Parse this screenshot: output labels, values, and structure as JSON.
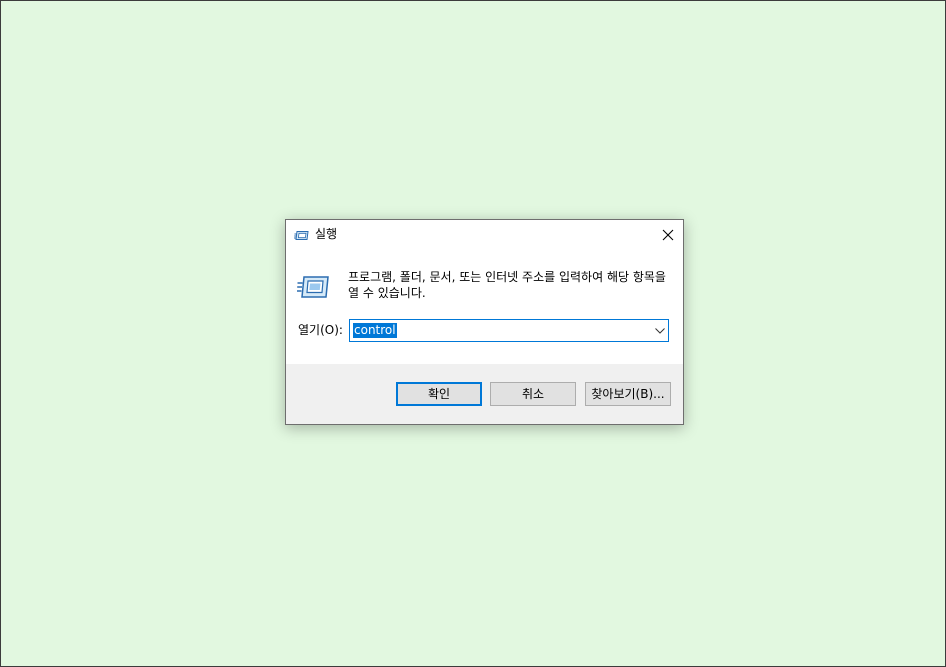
{
  "dialog": {
    "title": "실행",
    "title_icon": "run-icon",
    "close_icon": "close-icon",
    "instruction": "프로그램, 폴더, 문서, 또는 인터넷 주소를 입력하여 해당 항목을 열 수 있습니다.",
    "open_label": "열기(O):",
    "open_input": {
      "value": "control",
      "selected": true,
      "dropdown_icon": "chevron-down-icon"
    },
    "buttons": {
      "ok": "확인",
      "cancel": "취소",
      "browse": "찾아보기(B)..."
    }
  },
  "colors": {
    "desktop_background": "#e2f8e0",
    "accent": "#0078d7",
    "dialog_footer": "#f0f0f0",
    "button_face": "#e1e1e1"
  }
}
